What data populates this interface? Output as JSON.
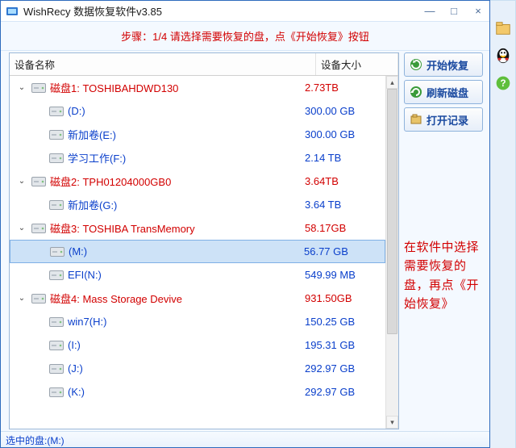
{
  "window": {
    "title": "WishRecy 数据恢复软件v3.85",
    "min": "—",
    "max": "□",
    "close": "×"
  },
  "banner": "步骤：1/4 请选择需要恢复的盘，点《开始恢复》按钮",
  "columns": {
    "name": "设备名称",
    "size": "设备大小"
  },
  "rows": [
    {
      "kind": "disk",
      "caret": "⌄",
      "label": "磁盘1: TOSHIBAHDWD130",
      "size": "2.73TB"
    },
    {
      "kind": "part",
      "label": "(D:)",
      "size": "300.00 GB"
    },
    {
      "kind": "part",
      "label": "新加卷(E:)",
      "size": "300.00 GB"
    },
    {
      "kind": "part",
      "label": "学习工作(F:)",
      "size": "2.14 TB"
    },
    {
      "kind": "disk",
      "caret": "⌄",
      "label": "磁盘2: TPH01204000GB0",
      "size": "3.64TB"
    },
    {
      "kind": "part",
      "label": "新加卷(G:)",
      "size": "3.64 TB"
    },
    {
      "kind": "disk",
      "caret": "⌄",
      "label": "磁盘3: TOSHIBA  TransMemory",
      "size": "58.17GB"
    },
    {
      "kind": "part",
      "label": "(M:)",
      "size": "56.77 GB",
      "selected": true
    },
    {
      "kind": "part",
      "label": "EFI(N:)",
      "size": "549.99 MB"
    },
    {
      "kind": "disk",
      "caret": "⌄",
      "label": "磁盘4: Mass Storage Devive",
      "size": "931.50GB"
    },
    {
      "kind": "part",
      "label": "win7(H:)",
      "size": "150.25 GB"
    },
    {
      "kind": "part",
      "label": "(I:)",
      "size": "195.31 GB"
    },
    {
      "kind": "part",
      "label": "(J:)",
      "size": "292.97 GB"
    },
    {
      "kind": "part",
      "label": "(K:)",
      "size": "292.97 GB"
    }
  ],
  "actions": {
    "start": "开始恢复",
    "refresh": "刷新磁盘",
    "openlog": "打开记录"
  },
  "annotation": "在软件中选择需要恢复的盘，再点《开始恢复》",
  "status": "选中的盘:(M:)"
}
